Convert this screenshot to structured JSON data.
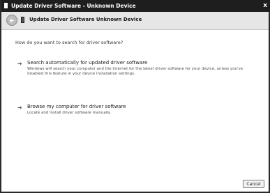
{
  "window": {
    "title": "Update Driver Software - Unknown Device",
    "close_glyph": "x"
  },
  "nav": {
    "title": "Update Driver Software   Unknown Device"
  },
  "content": {
    "question": "How do you want to search for driver software?",
    "options": [
      {
        "title": "Search automatically for updated driver software",
        "description": "Windows will search your computer and the Internet for the latest driver software for your device, unless you've disabled this feature in your device installation settings.",
        "icon": "arrow-right-icon"
      },
      {
        "title": "Browse my computer for driver software",
        "description": "Locate and install driver software manually.",
        "icon": "arrow-right-icon"
      }
    ]
  },
  "footer": {
    "cancel_label": "Cancel"
  }
}
